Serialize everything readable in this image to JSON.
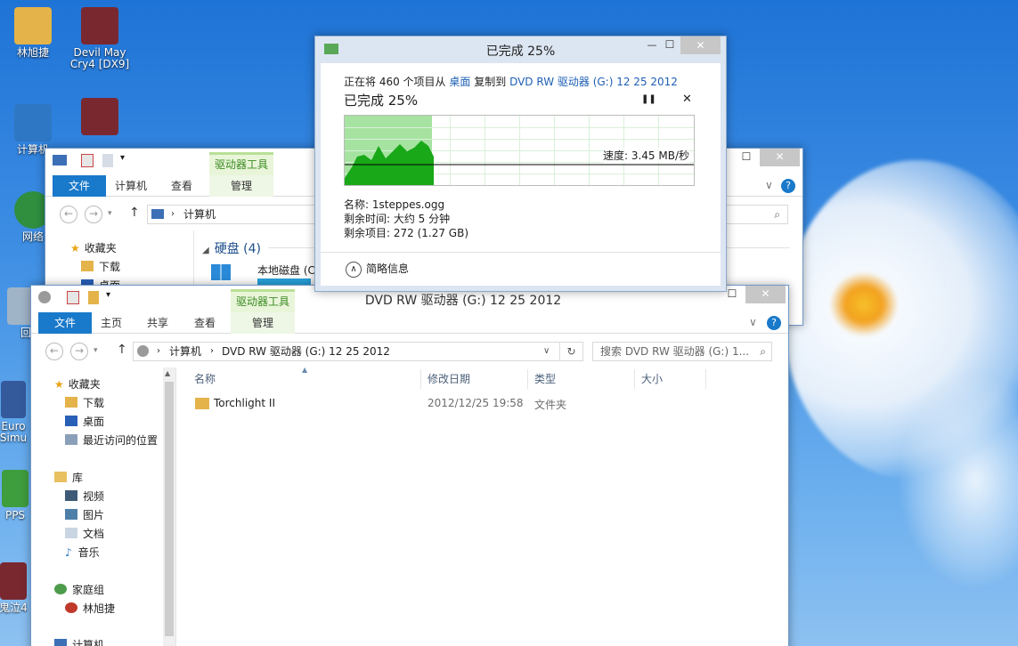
{
  "desktop": {
    "icons": [
      {
        "label": "林旭捷",
        "color": "#e4b34a"
      },
      {
        "label": "Devil May Cry4 [DX9]",
        "color": "#7a2830"
      },
      {
        "label": "计算机",
        "color": "#2e77c4"
      },
      {
        "label": "",
        "color": "#7a2830"
      },
      {
        "label": "网络",
        "color": "#2f8f3f"
      },
      {
        "label": "回",
        "color": "#a0b4c8"
      },
      {
        "label": "Euro Simu",
        "color": "#355a9c"
      },
      {
        "label": "PPS",
        "color": "#3e9d3d"
      },
      {
        "label": "鬼泣4",
        "color": "#7a2830"
      }
    ]
  },
  "copy_dialog": {
    "title": "已完成 25%",
    "message_prefix": "正在将 460 个项目从",
    "source": "桌面",
    "verb": "复制到",
    "destination": "DVD RW 驱动器 (G:) 12 25 2012",
    "status": "已完成 25%",
    "pause_glyph": "❚❚",
    "cancel_glyph": "✕",
    "progress": 0.25,
    "speed": "速度: 3.45 MB/秒",
    "name_label": "名称: 1steppes.ogg",
    "time_label": "剩余时间: 大约 5 分钟",
    "items_label": "剩余项目: 272 (1.27 GB)",
    "details_toggle": "简略信息",
    "minimize": "—",
    "maximize": "☐",
    "close": "✕"
  },
  "back_window": {
    "context_tab": "驱动器工具",
    "tabs": [
      "文件",
      "计算机",
      "查看",
      "管理"
    ],
    "address": "计算机",
    "nav_items": [
      "收藏夹",
      "下载",
      "桌面"
    ],
    "group_header": "硬盘 (4)",
    "drive_label": "本地磁盘 (C",
    "minimize": "—",
    "maximize": "☐",
    "close": "✕",
    "help": "?",
    "search_icon": "⌕"
  },
  "front_window": {
    "title": "DVD RW 驱动器 (G:) 12 25 2012",
    "context_tab": "驱动器工具",
    "tabs": [
      "文件",
      "主页",
      "共享",
      "查看",
      "管理"
    ],
    "address_parts": [
      "计算机",
      "DVD RW 驱动器 (G:) 12 25 2012"
    ],
    "search_placeholder": "搜索 DVD RW 驱动器 (G:) 1...",
    "columns": [
      "名称",
      "修改日期",
      "类型",
      "大小"
    ],
    "files": [
      {
        "name": "Torchlight II",
        "modified": "2012/12/25 19:58",
        "type": "文件夹",
        "size": ""
      }
    ],
    "nav": {
      "favorites": "收藏夹",
      "fav_items": [
        "下载",
        "桌面",
        "最近访问的位置"
      ],
      "libraries": "库",
      "lib_items": [
        "视频",
        "图片",
        "文档",
        "音乐"
      ],
      "homegroup": "家庭组",
      "home_items": [
        "林旭捷"
      ],
      "computer": "计算机"
    },
    "minimize": "—",
    "maximize": "☐",
    "close": "✕",
    "help": "?"
  },
  "colors": {
    "accent": "#1979ca",
    "progress": "#a6e3a1",
    "graph": "#18a818"
  }
}
